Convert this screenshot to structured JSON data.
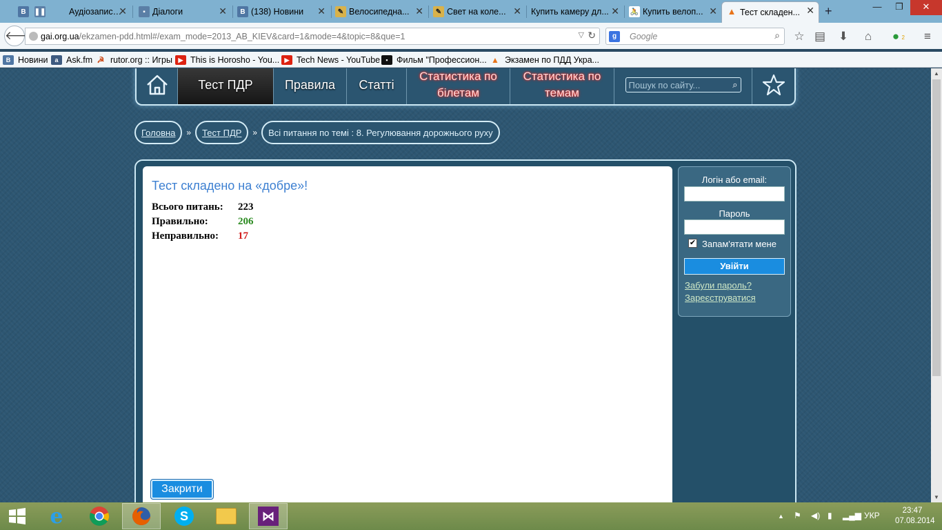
{
  "browser": {
    "tabs": [
      {
        "label": "Аудіозаписи ...",
        "icon": "vk-icon"
      },
      {
        "label": "Діалоги",
        "icon": "vk-icon"
      },
      {
        "label": "(138) Новини",
        "icon": "vk-icon"
      },
      {
        "label": "Велосипедна...",
        "icon": "bike-site-icon"
      },
      {
        "label": "Свет на коле...",
        "icon": "bike-site-icon"
      },
      {
        "label": "Купить камеру дл...",
        "icon": "none"
      },
      {
        "label": "Купить велоп...",
        "icon": "cyclist-icon"
      },
      {
        "label": "Тест складен...",
        "icon": "cone-icon"
      }
    ],
    "url_domain": "gai.org.ua",
    "url_path": "/ekzamen-pdd.html#/exam_mode=2013_AB_KIEV&card=1&mode=4&topic=8&que=1",
    "search_placeholder": "Google",
    "addon_badge": "2",
    "bookmarks": [
      {
        "label": "Новини"
      },
      {
        "label": "Ask.fm"
      },
      {
        "label": "rutor.org :: Игры"
      },
      {
        "label": "This is Horosho - You..."
      },
      {
        "label": "Tech News - YouTube"
      },
      {
        "label": "Фильм \"Профессион..."
      },
      {
        "label": "Экзамен по ПДД Укра..."
      }
    ]
  },
  "site": {
    "menu": {
      "items": [
        "Тест ПДР",
        "Правила",
        "Статті",
        "Статистика по білетам",
        "Статистика по темам"
      ],
      "search_placeholder": "Пошук по сайту..."
    },
    "breadcrumb": {
      "home": "Головна",
      "test": "Тест ПДР",
      "current": "Всі питання по темі : 8. Регулювання дорожнього руху",
      "separator": "»"
    },
    "result": {
      "title": "Тест складено на «добре»!",
      "total_label": "Всього питань:",
      "total_value": "223",
      "correct_label": "Правильно:",
      "correct_value": "206",
      "wrong_label": "Неправильно:",
      "wrong_value": "17",
      "close_label": "Закрити"
    },
    "login": {
      "login_label": "Логін або email:",
      "password_label": "Пароль",
      "remember_label": "Запам'ятати мене",
      "submit_label": "Увійти",
      "forgot_label": "Забули пароль?",
      "register_label": "Зареєструватися"
    }
  },
  "taskbar": {
    "language": "УКР",
    "time": "23:47",
    "date": "07.08.2014"
  },
  "colors": {
    "accent": "#1a8de0",
    "correct": "#2a8a1f",
    "wrong": "#d21b1b",
    "title": "#3c7fd1"
  }
}
